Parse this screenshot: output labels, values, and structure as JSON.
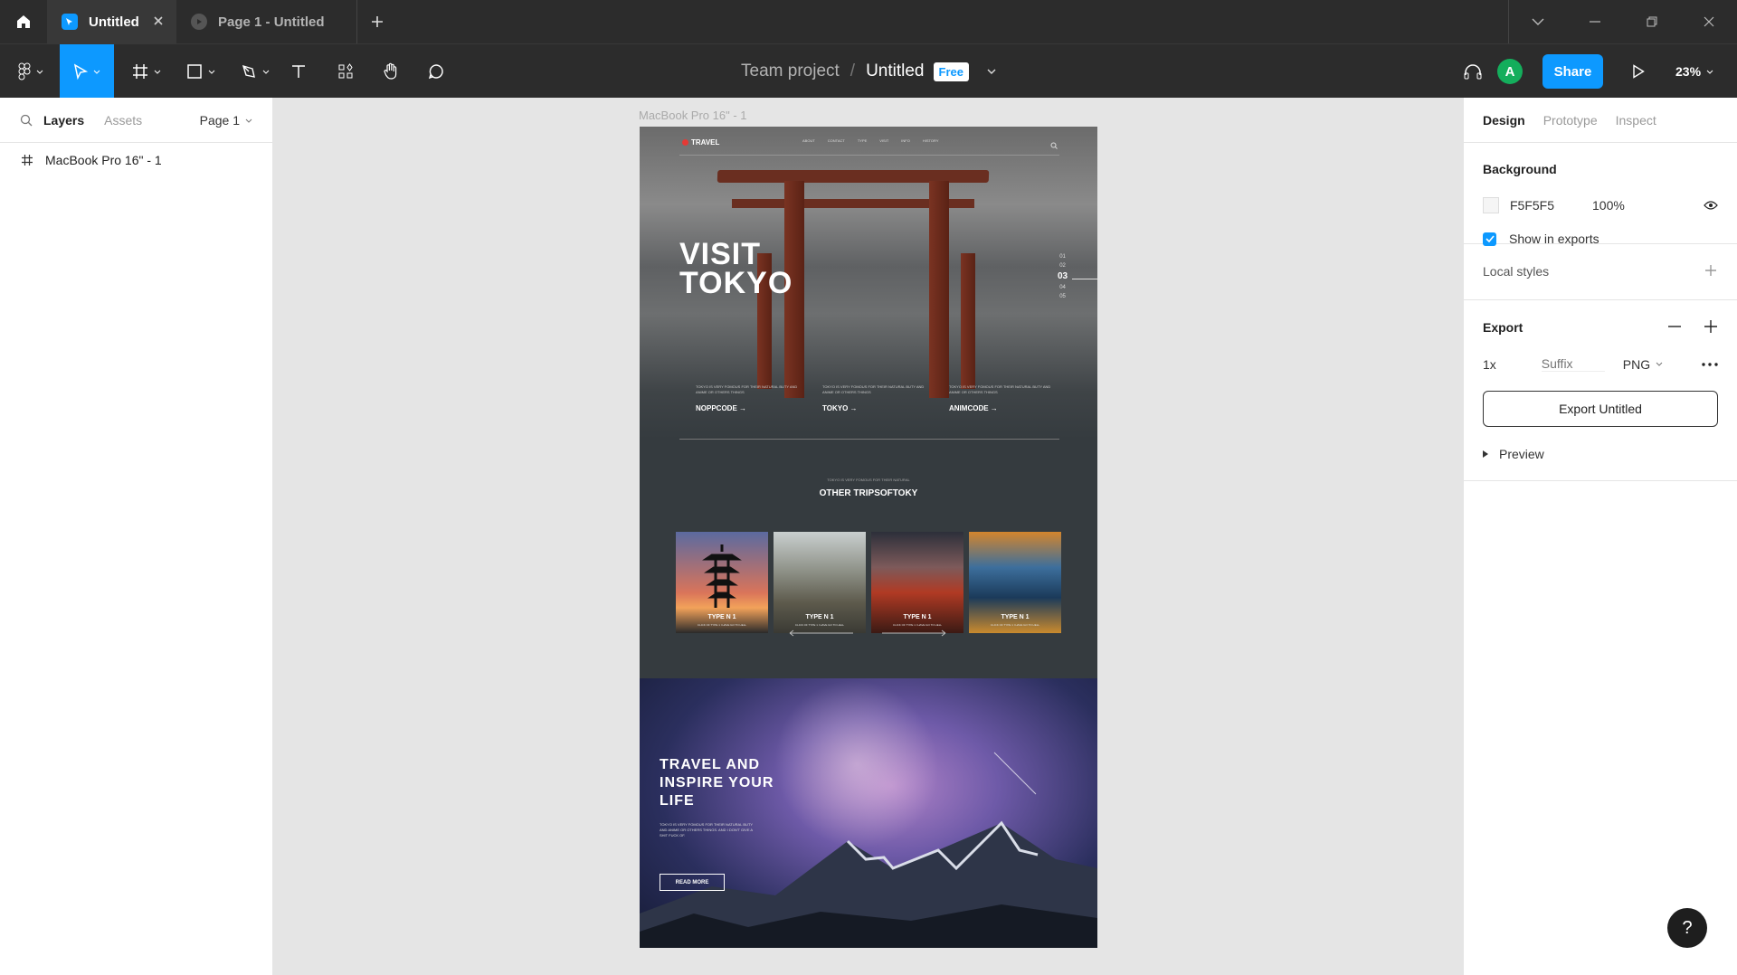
{
  "titlebar": {
    "tabs": [
      {
        "label": "Untitled",
        "active": true
      },
      {
        "label": "Page 1 - Untitled",
        "active": false
      }
    ]
  },
  "toolbar": {
    "team": "Team project",
    "separator": "/",
    "file_name": "Untitled",
    "plan_badge": "Free",
    "avatar_initial": "A",
    "share_label": "Share",
    "zoom": "23%"
  },
  "left_panel": {
    "tab_layers": "Layers",
    "tab_assets": "Assets",
    "page": "Page 1",
    "layers": [
      "MacBook Pro 16\" - 1"
    ]
  },
  "canvas": {
    "frame_label": "MacBook Pro 16\" - 1",
    "site": {
      "logo": "TRAVEL",
      "nav": [
        "ABOUT",
        "CONTACT",
        "TYPE",
        "VISIT",
        "INFO",
        "HISTORY"
      ],
      "hero_line1": "VISIT",
      "hero_line2": "TOKYO",
      "slides": [
        "01",
        "02",
        "03",
        "04",
        "05"
      ],
      "current_slide": "03",
      "columns": [
        {
          "desc": "TOKYO IS VERY FOMOUS FOR THEIR NATURAL BUTY AND ANIME OR OTHERS THINGS",
          "head": "NOPPCODE →"
        },
        {
          "desc": "TOKYO IS VERY FOMOUS FOR THEIR NATURAL BUTY AND ANIME OR OTHERS THINGS",
          "head": "TOKYO →"
        },
        {
          "desc": "TOKYO IS VERY FOMOUS FOR THEIR NATURAL BUTY AND ANIME OR OTHERS THINGS",
          "head": "ANIMCODE →"
        }
      ],
      "mid_sub": "TOKYO IS VERY FOMOUS FOR THEIR NATURAL",
      "mid_title": "OTHER TRIPSOFTOKY",
      "cards": [
        {
          "title": "TYPE N 1",
          "sub": "CLICK OF TYPE 1 I HAVE GO TO HELL"
        },
        {
          "title": "TYPE N 1",
          "sub": "CLICK OF TYPE 1 I HAVE GO TO HELL"
        },
        {
          "title": "TYPE N 1",
          "sub": "CLICK OF TYPE 1 I HAVE GO TO HELL"
        },
        {
          "title": "TYPE N 1",
          "sub": "CLICK OF TYPE 1 I HAVE GO TO HELL"
        }
      ],
      "bottom_line1": "TRAVEL AND",
      "bottom_line2": "INSPIRE YOUR",
      "bottom_line3": "LIFE",
      "bottom_desc": "TOKYO IS VERY FOMOUS FOR THEIR NATURAL BUTY AND ANIME OR OTHERS THINGS. AND I DON'T GIVE A SHIT FUCK OF.",
      "read_more": "READ MORE"
    }
  },
  "right_panel": {
    "tabs": [
      "Design",
      "Prototype",
      "Inspect"
    ],
    "background": {
      "title": "Background",
      "hex": "F5F5F5",
      "opacity": "100%",
      "show_in_exports": "Show in exports"
    },
    "local_styles": "Local styles",
    "export": {
      "title": "Export",
      "scale": "1x",
      "suffix_placeholder": "Suffix",
      "format": "PNG",
      "button": "Export Untitled",
      "preview": "Preview"
    }
  },
  "help": "?"
}
